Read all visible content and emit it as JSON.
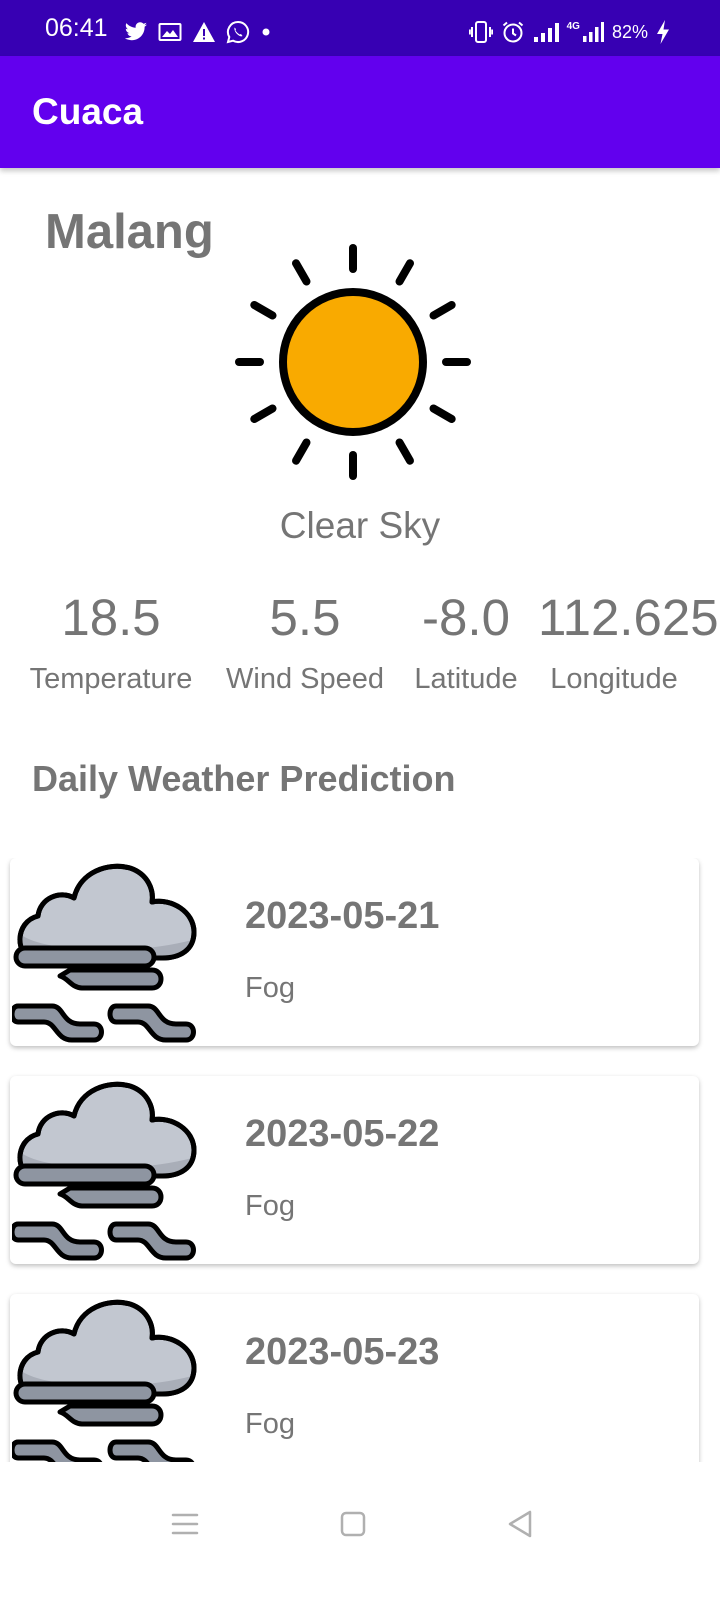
{
  "status_bar": {
    "time": "06:41",
    "battery": "82%",
    "network": "4G",
    "background": "#3700b3",
    "icons_left": [
      "twitter-icon",
      "gallery-icon",
      "warning-icon",
      "whatsapp-icon",
      "dot-icon"
    ],
    "icons_right": [
      "vibrate-icon",
      "alarm-icon",
      "signal-icon",
      "signal-4g-icon",
      "battery-charging-icon"
    ]
  },
  "app_bar": {
    "title": "Cuaca",
    "background": "#6200ee"
  },
  "current": {
    "city": "Malang",
    "condition": "Clear Sky",
    "icon": "sun-icon",
    "stats": [
      {
        "value": "18.5",
        "label": "Temperature"
      },
      {
        "value": "5.5",
        "label": "Wind Speed"
      },
      {
        "value": "-8.0",
        "label": "Latitude"
      },
      {
        "value": "112.625",
        "label": "Longitude"
      }
    ]
  },
  "forecast": {
    "title": "Daily Weather Prediction",
    "items": [
      {
        "date": "2023-05-21",
        "description": "Fog",
        "icon": "fog-icon"
      },
      {
        "date": "2023-05-22",
        "description": "Fog",
        "icon": "fog-icon"
      },
      {
        "date": "2023-05-23",
        "description": "Fog",
        "icon": "fog-icon"
      }
    ]
  },
  "nav_bar": {
    "buttons": [
      "menu-icon",
      "home-icon",
      "back-icon"
    ]
  },
  "colors": {
    "primary": "#6200ee",
    "primary_dark": "#3700b3",
    "text_gray": "#757575",
    "sun": "#f9aa00",
    "cloud": "#c2c7d0"
  }
}
